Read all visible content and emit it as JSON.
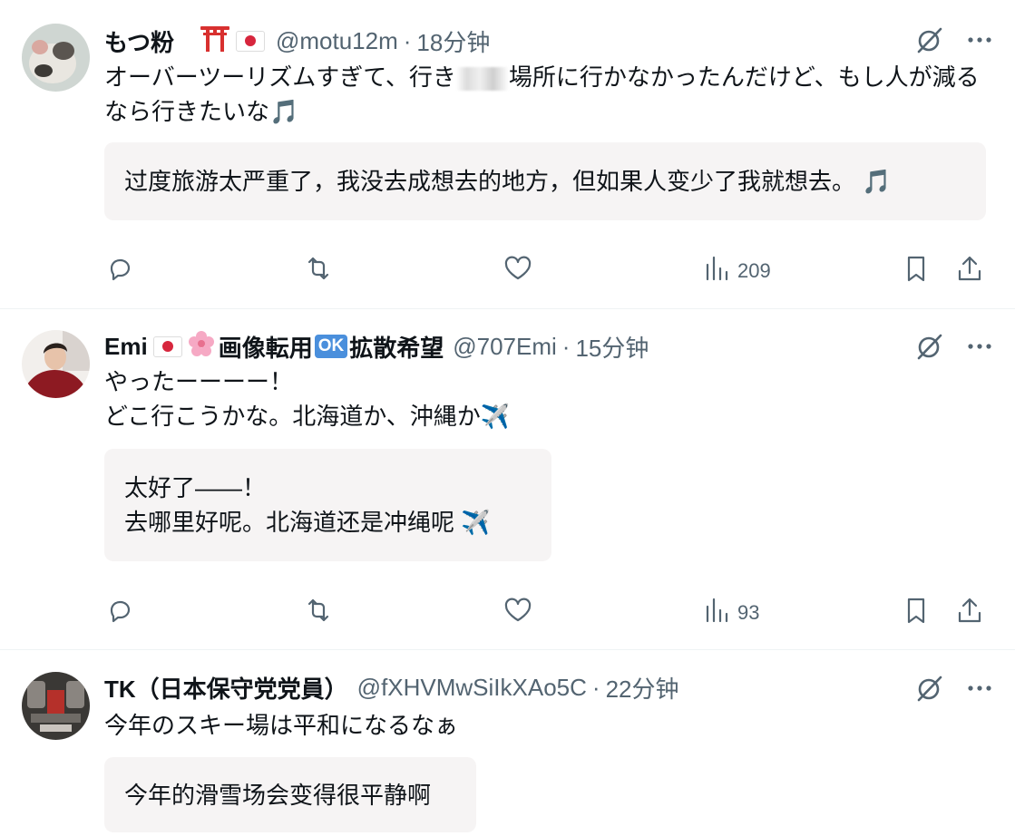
{
  "tweets": [
    {
      "name": "もつ粉",
      "handle": "@motu12m",
      "separator": "·",
      "time": "18分钟",
      "text_before": "オーバーツーリズムすぎて、行き",
      "text_after": "場所に行かなかったんだけど、もし人が減るなら行きたいな🎵",
      "translation": "过度旅游太严重了，我没去成想去的地方，但如果人变少了我就想去。 🎵",
      "views": "209"
    },
    {
      "name": "Emi",
      "name_suffix": "画像転用",
      "ok_badge": "OK",
      "name_suffix2": "拡散希望",
      "handle": "@707Emi",
      "separator": "·",
      "time": "15分钟",
      "text": "やったーーーー！\nどこ行こうかな。北海道か、沖縄か✈️",
      "translation": "太好了——！\n去哪里好呢。北海道还是冲绳呢 ✈️",
      "views": "93"
    },
    {
      "name": "TK（日本保守党党員）",
      "handle": "@fXHVMwSiIkXAo5C",
      "separator": "·",
      "time": "22分钟",
      "text": "今年のスキー場は平和になるなぁ",
      "translation": "今年的滑雪场会变得很平静啊"
    }
  ],
  "icons": {
    "grok": "grok-slash-icon",
    "more": "more-dots-icon",
    "reply": "reply-icon",
    "retweet": "retweet-icon",
    "like": "heart-icon",
    "views": "views-bar-icon",
    "bookmark": "bookmark-icon",
    "share": "share-icon"
  },
  "colors": {
    "text": "#0f1419",
    "secondary": "#536471",
    "translation_bg": "#f6f4f4",
    "divider": "#eff3f4"
  }
}
